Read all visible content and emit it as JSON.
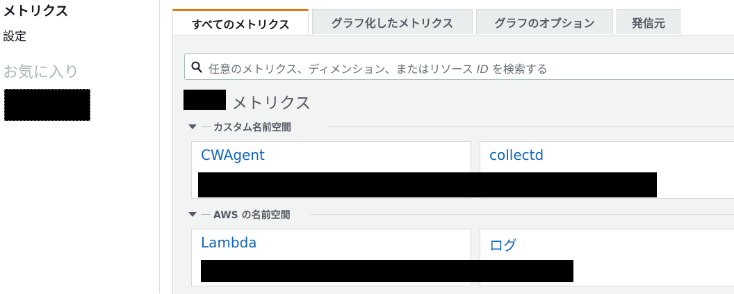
{
  "sidebar": {
    "title": "メトリクス",
    "settings": "設定",
    "favorites": "お気に入り"
  },
  "tabs": [
    {
      "label": "すべてのメトリクス",
      "active": true
    },
    {
      "label": "グラフ化したメトリクス",
      "active": false
    },
    {
      "label": "グラフのオプション",
      "active": false
    },
    {
      "label": "発信元",
      "active": false
    }
  ],
  "search": {
    "placeholder_prefix": "任意のメトリクス、ディメンション、またはリソース ",
    "placeholder_id": "ID",
    "placeholder_suffix": " を検索する"
  },
  "metrics_header": "メトリクス",
  "sections": [
    {
      "label": "カスタム名前空間",
      "cards": [
        "CWAgent",
        "collectd"
      ]
    },
    {
      "label": "AWS の名前空間",
      "cards": [
        "Lambda",
        "ログ"
      ]
    }
  ],
  "colors": {
    "accent_tab": "#ec7211",
    "link": "#1166bb"
  },
  "icons": {
    "search": "search-icon",
    "collapse": "caret-down-icon"
  }
}
